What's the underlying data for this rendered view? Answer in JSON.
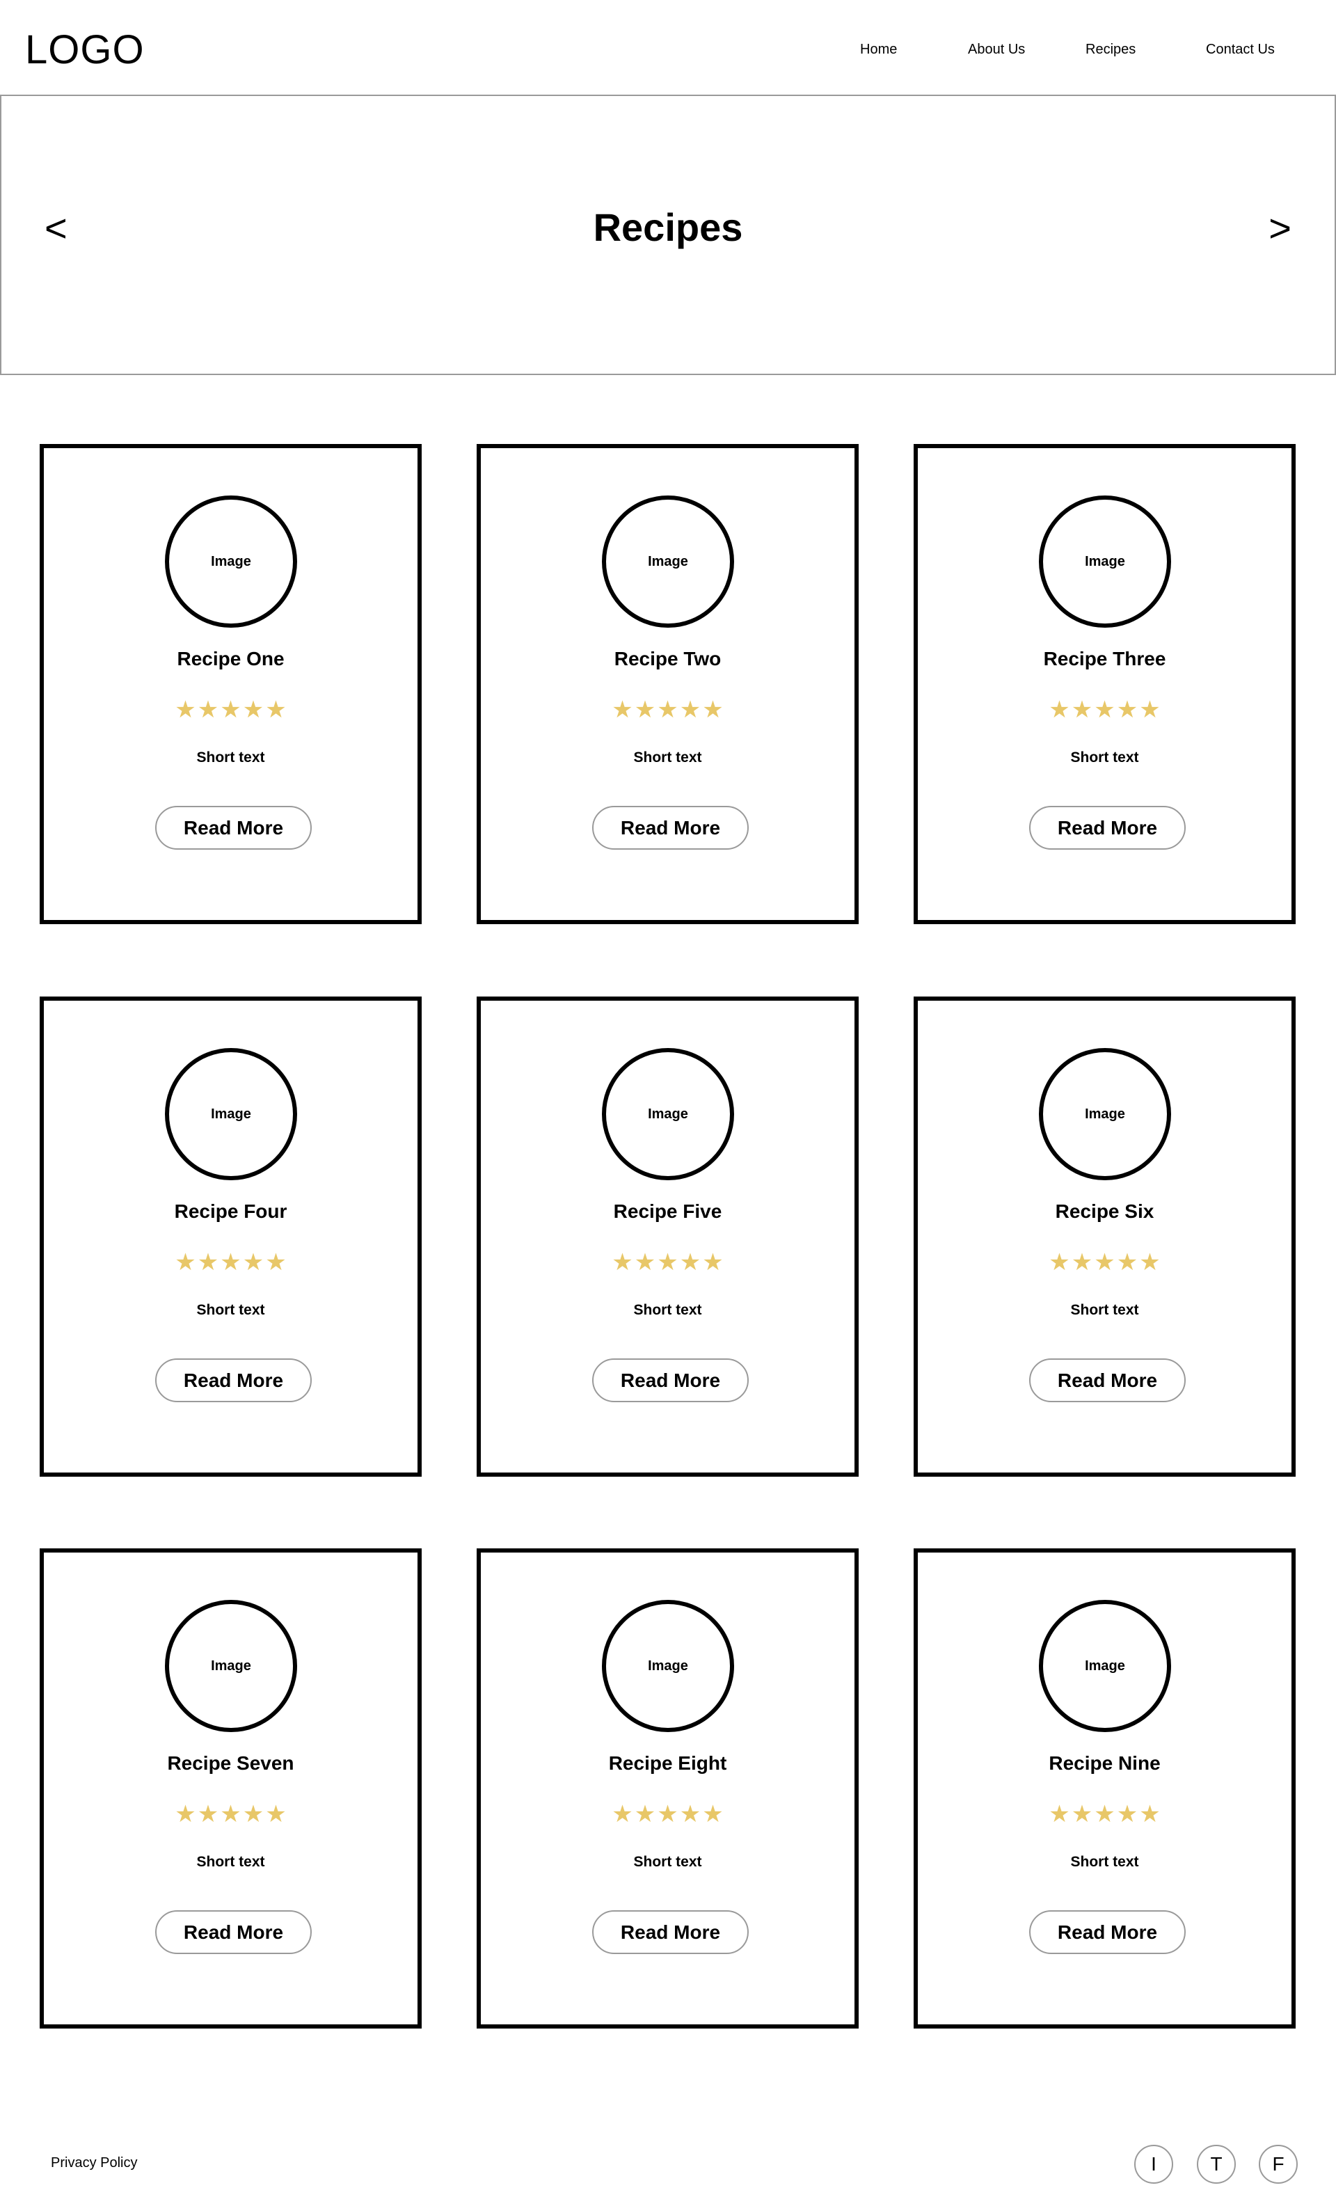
{
  "header": {
    "logo": "LOGO",
    "nav": [
      "Home",
      "About Us",
      "Recipes",
      "Contact Us"
    ]
  },
  "hero": {
    "title": "Recipes",
    "prev_label": "<",
    "next_label": ">"
  },
  "recipes": [
    {
      "image_label": "Image",
      "title": "Recipe One",
      "rating": 5,
      "text": "Short text",
      "button": "Read More"
    },
    {
      "image_label": "Image",
      "title": "Recipe Two",
      "rating": 5,
      "text": "Short text",
      "button": "Read More"
    },
    {
      "image_label": "Image",
      "title": "Recipe Three",
      "rating": 5,
      "text": "Short text",
      "button": "Read More"
    },
    {
      "image_label": "Image",
      "title": "Recipe Four",
      "rating": 5,
      "text": "Short text",
      "button": "Read More"
    },
    {
      "image_label": "Image",
      "title": "Recipe Five",
      "rating": 5,
      "text": "Short text",
      "button": "Read More"
    },
    {
      "image_label": "Image",
      "title": "Recipe Six",
      "rating": 5,
      "text": "Short text",
      "button": "Read More"
    },
    {
      "image_label": "Image",
      "title": "Recipe Seven",
      "rating": 5,
      "text": "Short text",
      "button": "Read More"
    },
    {
      "image_label": "Image",
      "title": "Recipe Eight",
      "rating": 5,
      "text": "Short text",
      "button": "Read More"
    },
    {
      "image_label": "Image",
      "title": "Recipe Nine",
      "rating": 5,
      "text": "Short text",
      "button": "Read More"
    }
  ],
  "footer": {
    "privacy": "Privacy Policy",
    "social": [
      "I",
      "T",
      "F"
    ]
  },
  "colors": {
    "star": "#e8c768",
    "border": "#000000",
    "subtle_border": "#9a9a9a"
  }
}
